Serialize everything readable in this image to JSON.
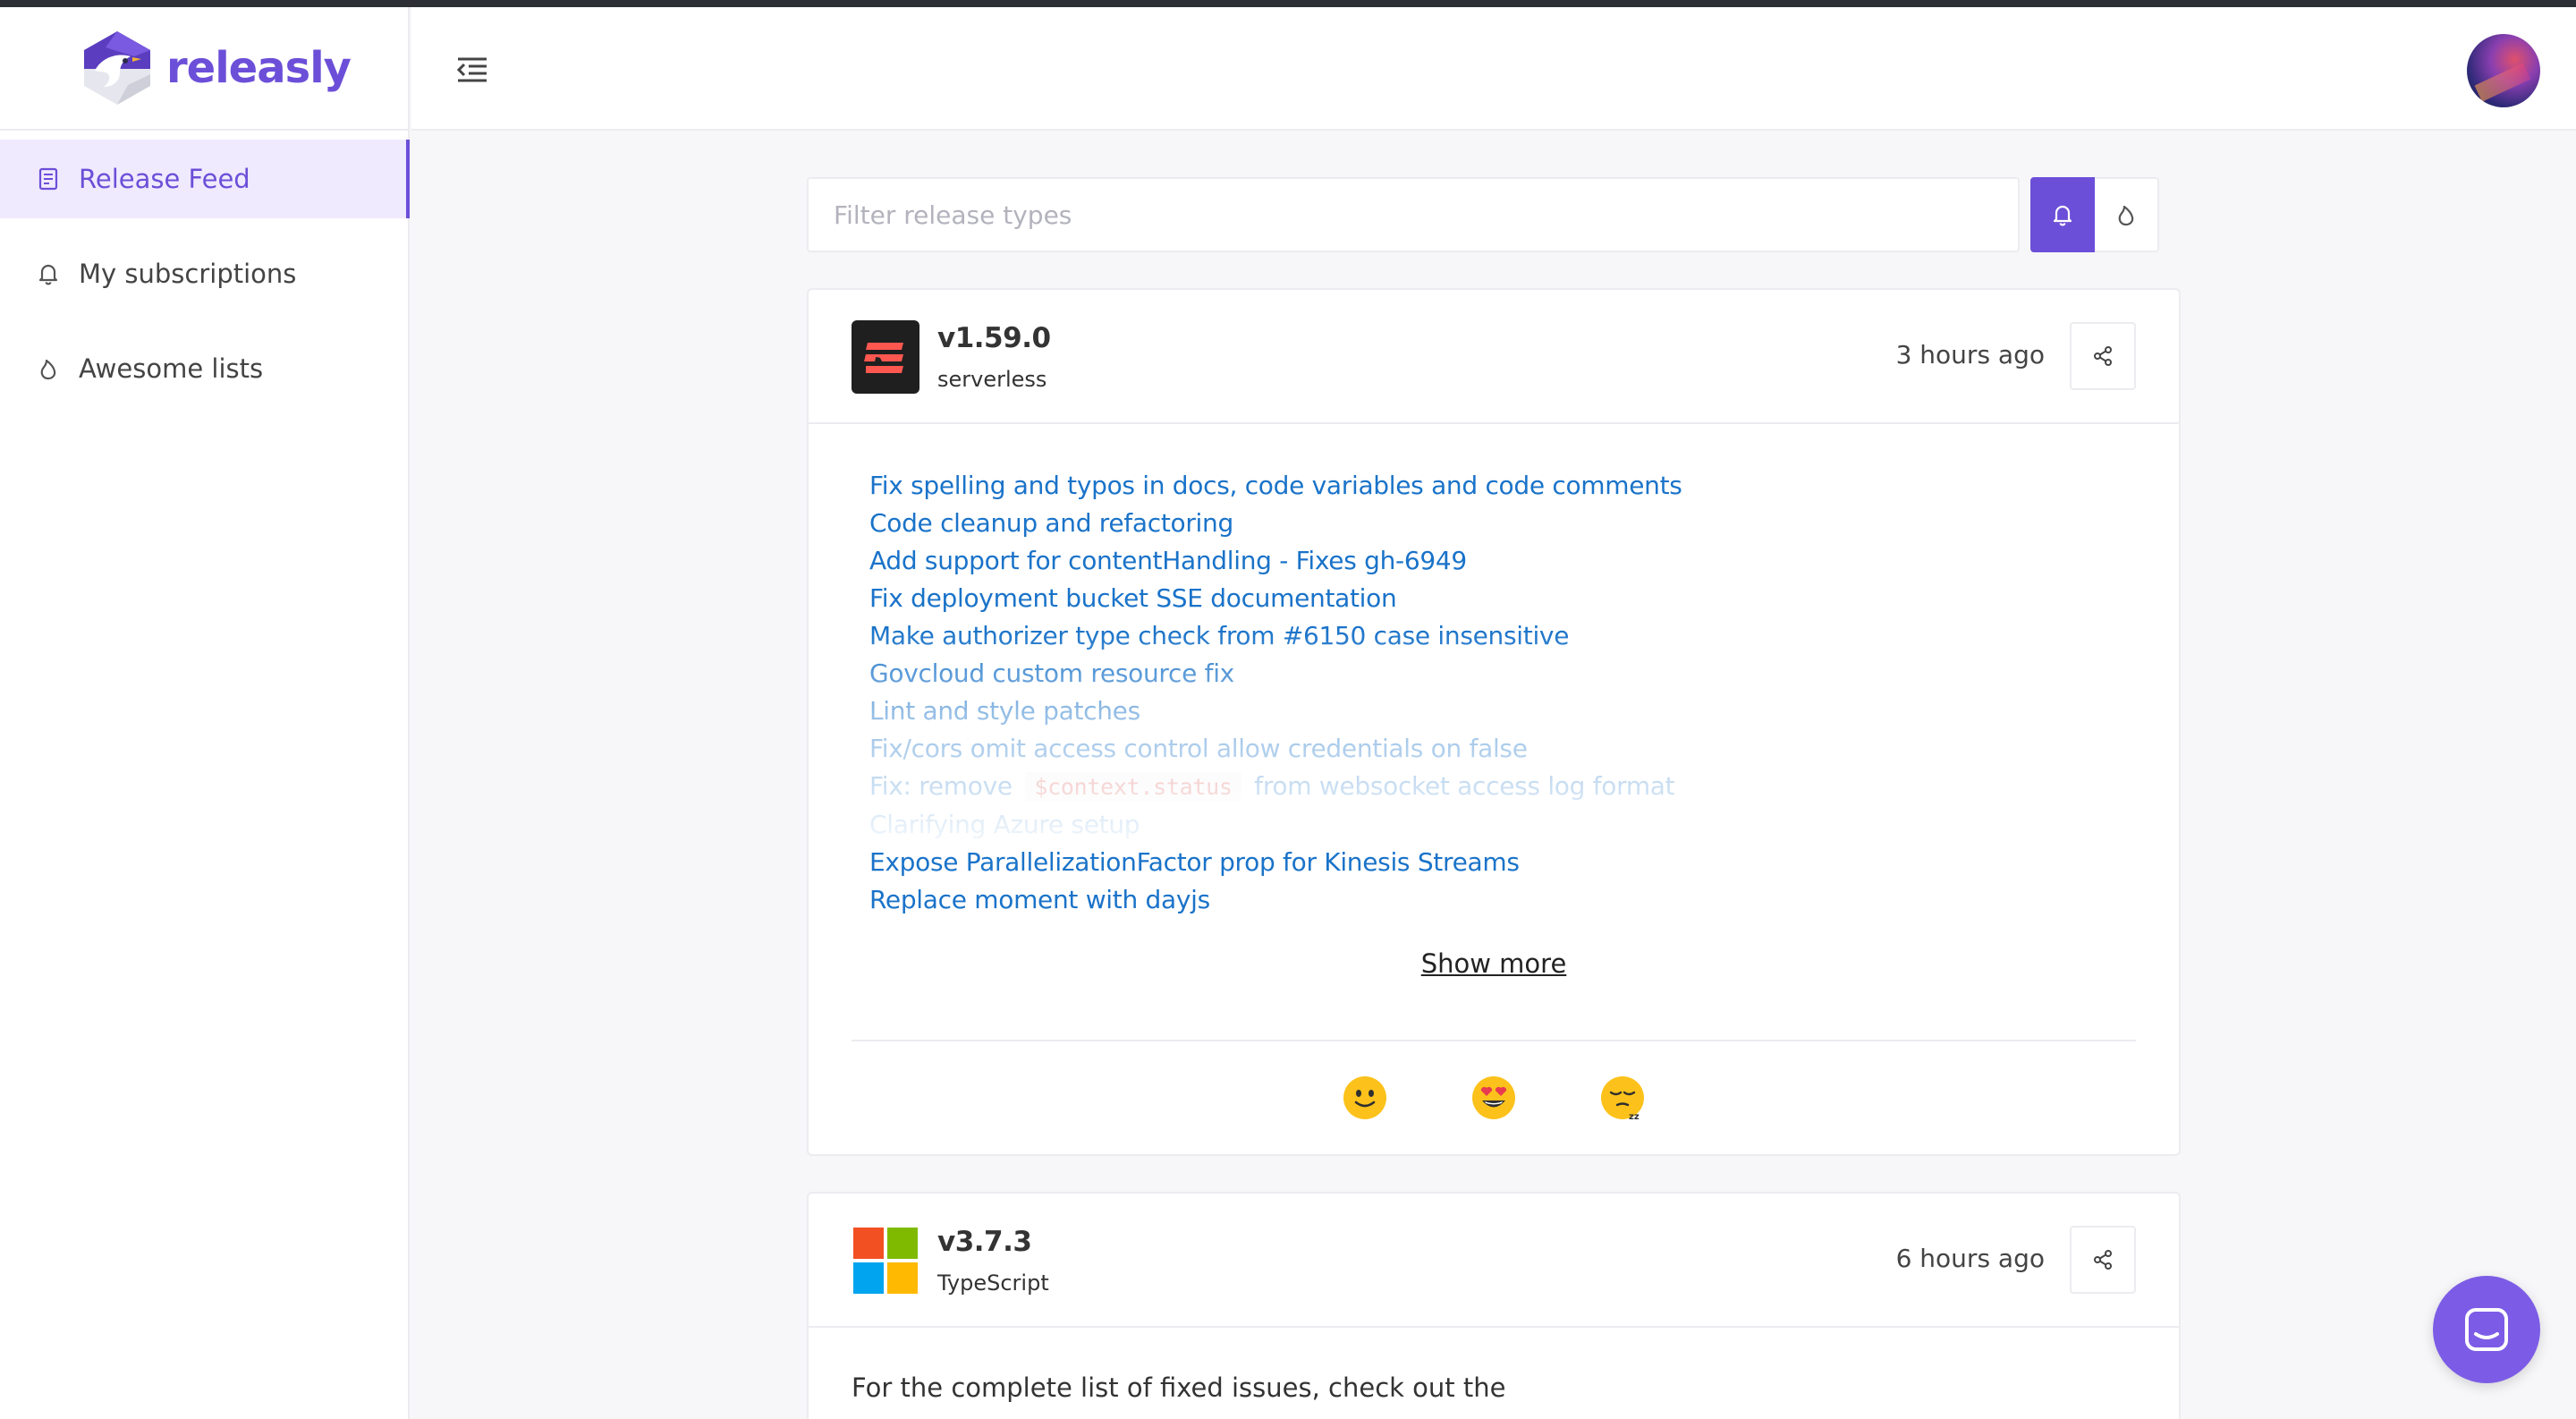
{
  "app": {
    "name": "releasly"
  },
  "sidebar": {
    "items": [
      {
        "label": "Release Feed",
        "icon": "document-icon",
        "active": true
      },
      {
        "label": "My subscriptions",
        "icon": "bell-icon",
        "active": false
      },
      {
        "label": "Awesome lists",
        "icon": "flame-icon",
        "active": false
      }
    ]
  },
  "filter": {
    "placeholder": "Filter release types"
  },
  "releases": [
    {
      "version": "v1.59.0",
      "project": "serverless",
      "time": "3 hours ago",
      "notes": [
        "Fix spelling and typos in docs, code variables and code comments",
        "Code cleanup and refactoring",
        "Add support for contentHandling - Fixes gh-6949",
        "Fix deployment bucket SSE documentation",
        "Make authorizer type check from #6150 case insensitive",
        "Govcloud custom resource fix",
        "Lint and style patches",
        "Fix/cors omit access control allow credentials on false"
      ],
      "note_code_line": {
        "prefix": "Fix: remove",
        "code": "$context.status",
        "suffix": "from websocket access log format"
      },
      "notes_tail": [
        "Clarifying Azure setup",
        "Expose ParallelizationFactor prop for Kinesis Streams",
        "Replace moment with dayjs"
      ],
      "show_more": "Show more",
      "reactions": [
        "slightly-smiling-face",
        "heart-eyes-face",
        "sleeping-face"
      ]
    },
    {
      "version": "v3.7.3",
      "project": "TypeScript",
      "time": "6 hours ago",
      "body": "For the complete list of fixed issues, check out the"
    }
  ],
  "colors": {
    "accent": "#6c4fd8",
    "link": "#1a73c9",
    "code": "#d9534f"
  }
}
